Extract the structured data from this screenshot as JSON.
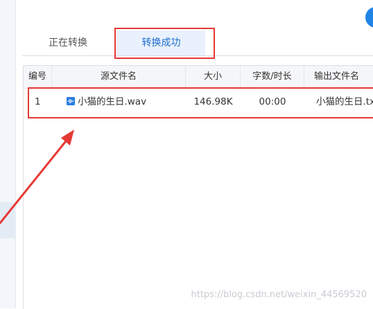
{
  "tabs": {
    "converting_label": "正在转换",
    "success_label": "转换成功",
    "active": "success"
  },
  "table": {
    "headers": {
      "index": "编号",
      "source_file": "源文件名",
      "size": "大小",
      "words_duration": "字数/时长",
      "output_file": "输出文件名"
    },
    "rows": [
      {
        "index": "1",
        "source_file": "小猫的生日.wav",
        "size": "146.98K",
        "duration": "00:00",
        "output_file": "小猫的生日.txt"
      }
    ]
  },
  "icons": {
    "file": "audio-file-icon",
    "corner": "circle-button-icon"
  },
  "colors": {
    "accent": "#1e84e6",
    "annotation": "#e53935",
    "active_tab_bg": "#e8f1fc"
  },
  "watermark": "https://blog.csdn.net/weixin_44569520"
}
